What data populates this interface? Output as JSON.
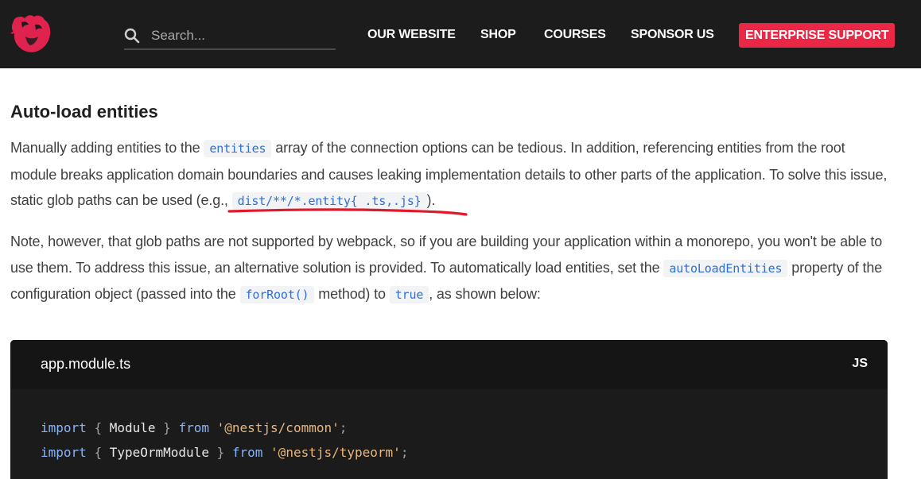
{
  "colors": {
    "topbar": "#1c1c1c",
    "accent": "#ea2845",
    "inline_code": "#2f6fd6",
    "code_bg": "#1b1b1b",
    "annotation_underline": "#e01a2c"
  },
  "header": {
    "logo_icon": "nestjs-cat-logo-icon",
    "search": {
      "icon": "search-icon",
      "placeholder": "Search..."
    },
    "nav": [
      {
        "label": "OUR WEBSITE"
      },
      {
        "label": "SHOP"
      },
      {
        "label": "COURSES"
      },
      {
        "label": "SPONSOR US"
      }
    ],
    "cta": {
      "label": "ENTERPRISE SUPPORT"
    }
  },
  "article": {
    "heading": "Auto-load entities",
    "p1": {
      "t1": "Manually adding entities to the ",
      "c1": "entities",
      "t2": " array of the connection options can be tedious. In addition, referencing entities from the root module breaks application domain boundaries and causes leaking implementation details to other parts of the application. To solve this issue, static glob paths can be used (e.g., ",
      "c2": "dist/**/*.entity{ .ts,.js}",
      "t3": ")."
    },
    "p2": {
      "t1": "Note, however, that glob paths are not supported by webpack, so if you are building your application within a monorepo, you won't be able to use them. To address this issue, an alternative solution is provided. To automatically load entities, set the ",
      "c1": "autoLoadEntities",
      "t2": " property of the configuration object (passed into the ",
      "c2": "forRoot()",
      "t3": " method) to ",
      "c3": "true",
      "t4": ", as shown below:"
    }
  },
  "code_block": {
    "filename": "app.module.ts",
    "lang": "JS",
    "lines": [
      {
        "kw": "import",
        "open": "{",
        "name": "Module",
        "close": "}",
        "from": "from",
        "src": "'@nestjs/common'",
        "end": ";"
      },
      {
        "kw": "import",
        "open": "{",
        "name": "TypeOrmModule",
        "close": "}",
        "from": "from",
        "src": "'@nestjs/typeorm'",
        "end": ";"
      }
    ]
  }
}
